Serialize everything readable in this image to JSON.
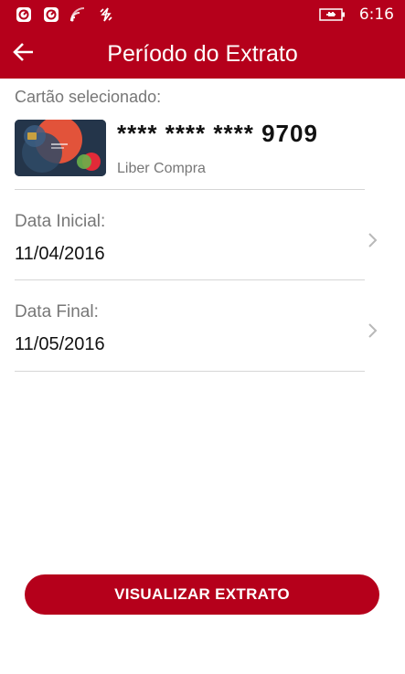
{
  "status_bar": {
    "time": "6:16",
    "icons": [
      "notification-icon",
      "notification-icon",
      "wifi-icon",
      "data-sync-icon",
      "battery-charging-icon"
    ]
  },
  "header": {
    "title": "Período do Extrato",
    "back_icon": "back-arrow-icon"
  },
  "card_section": {
    "label": "Cartão selecionado:",
    "card_number": "**** **** **** 9709",
    "card_type": "Liber Compra"
  },
  "start_date": {
    "label": "Data Inicial:",
    "value": "11/04/2016"
  },
  "end_date": {
    "label": "Data Final:",
    "value": "11/05/2016"
  },
  "actions": {
    "view_label": "VISUALIZAR EXTRATO"
  },
  "colors": {
    "brand": "#b5001b",
    "divider": "#d6d6d6",
    "muted_text": "#777777"
  }
}
